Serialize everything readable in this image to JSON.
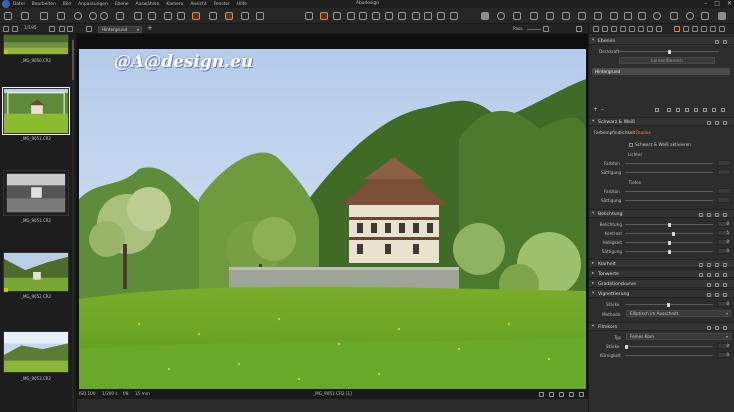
{
  "window": {
    "title": "Abadesign",
    "menu": [
      "Datei",
      "Bearbeiten",
      "Bild",
      "Anpassungen",
      "Ebene",
      "Auswählen",
      "Kamera",
      "Ansicht",
      "Fenster",
      "Hilfe"
    ],
    "controls": [
      "–",
      "□",
      "✕"
    ]
  },
  "browser": {
    "counter": "1/195",
    "thumbnails": [
      {
        "caption": "_MG_9050.CR2",
        "selected": false,
        "style": "green",
        "tag": "#c8c400"
      },
      {
        "caption": "_MG_9051.CR2",
        "selected": true,
        "style": "green",
        "tag": ""
      },
      {
        "caption": "_MG_9051.CR2",
        "selected": false,
        "style": "bw",
        "tag": ""
      },
      {
        "caption": "_MG_9052.CR2",
        "selected": false,
        "style": "valley",
        "tag": "#c8c400"
      },
      {
        "caption": "_MG_9053.CR2",
        "selected": false,
        "style": "hill",
        "tag": ""
      }
    ]
  },
  "viewer": {
    "variant": "Hintergrund",
    "add_variant": "+",
    "pass_label": "Pass.",
    "watermark": "@A@design.eu",
    "status": {
      "iso": "ISO 100",
      "shutter": "1/200 s",
      "aperture": "f/8",
      "focal": "15 mm",
      "filename": "_MG_9051.CR2 [1]"
    }
  },
  "panel": {
    "ebenen": {
      "title": "Ebenen",
      "opacity_label": "Deckkraft",
      "button": "Lernen/Bereich",
      "layer": "Hintergrund"
    },
    "sw": {
      "title": "Schwarz & Weiß",
      "tabs": [
        "Farbempfindlichkeit",
        "Duplex"
      ],
      "active_tab": "Duplex",
      "checkbox": "Schwarz & Weiß aktivieren",
      "lichter": "Lichter",
      "tiefen": "Tiefen",
      "farbton": "Farbton",
      "saettigung": "Sättigung"
    },
    "belichtung": {
      "title": "Belichtung",
      "rows": [
        {
          "label": "Belichtung",
          "value": "0",
          "level": 0.5
        },
        {
          "label": "Kontrast",
          "value": "5",
          "level": 0.55
        },
        {
          "label": "Helligkeit",
          "value": "0",
          "level": 0.5
        },
        {
          "label": "Sättigung",
          "value": "0",
          "level": 0.5
        }
      ]
    },
    "collapsed": [
      "Klarheit",
      "Tonwerte",
      "Gradationskurve"
    ],
    "vignettierung": {
      "title": "Vignettierung",
      "staerke_label": "Stärke",
      "staerke_value": "0",
      "methode_label": "Methode",
      "methode_value": "Elliptisch im Ausschnitt"
    },
    "filmkorn": {
      "title": "Filmkorn",
      "typ_label": "Typ",
      "typ_value": "Feines Korn",
      "staerke_label": "Stärke",
      "staerke_value": "0",
      "koernigkeit_label": "Körnigkeit",
      "koernigkeit_value": "0"
    }
  },
  "colors": {
    "accent": "#e8843a",
    "panel_bg": "#2d2d2d",
    "viewer_bg": "#0f0f0f"
  }
}
